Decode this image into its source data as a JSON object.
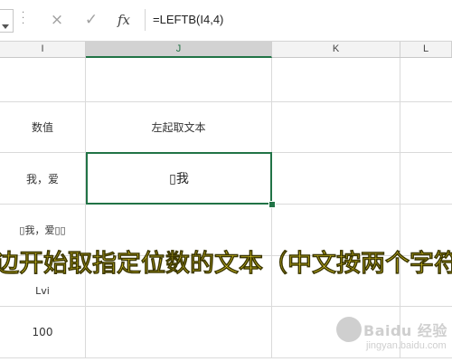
{
  "formula_bar": {
    "cancel_icon": "×",
    "confirm_icon": "✓",
    "fx_label": "fx",
    "formula": "=LEFTB(I4,4)"
  },
  "columns": [
    "I",
    "J",
    "K",
    "L"
  ],
  "rows": [
    {
      "i": "",
      "j": ""
    },
    {
      "i": "数值",
      "j": "左起取文本"
    },
    {
      "i": "我，爱",
      "j": "▯我"
    },
    {
      "i": "▯我，爱▯▯",
      "j": ""
    },
    {
      "i": "Lvi",
      "j": ""
    },
    {
      "i": "100",
      "j": ""
    }
  ],
  "caption": "边开始取指定位数的文本（中文按两个字符",
  "watermark": {
    "brand": "Baidu 经验",
    "url": "jingyan.baidu.com"
  }
}
